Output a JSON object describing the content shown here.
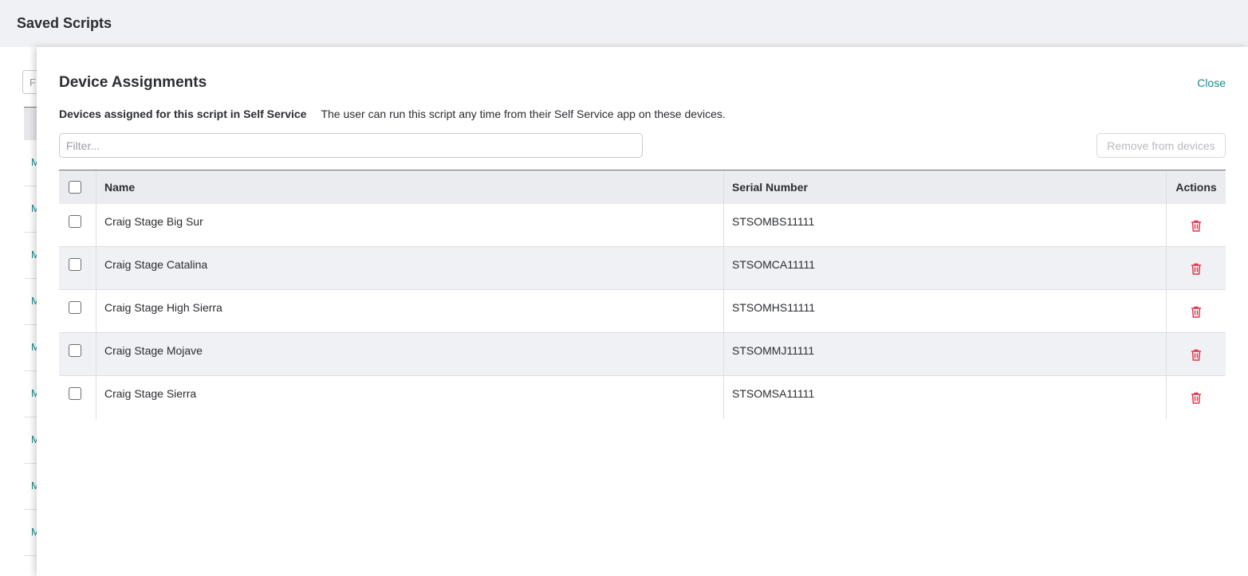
{
  "page": {
    "title": "Saved Scripts"
  },
  "background": {
    "filter_placeholder": "F",
    "row_letters": [
      "M",
      "M",
      "M",
      "M",
      "M",
      "M",
      "M",
      "M",
      "M"
    ]
  },
  "modal": {
    "title": "Device Assignments",
    "close_label": "Close",
    "subtitle_bold": "Devices assigned for this script in Self Service",
    "subtitle_text": "The user can run this script any time from their Self Service app on these devices.",
    "filter_placeholder": "Filter...",
    "remove_button_label": "Remove from devices",
    "table": {
      "headers": {
        "name": "Name",
        "serial": "Serial Number",
        "actions": "Actions"
      },
      "rows": [
        {
          "name": "Craig Stage Big Sur",
          "serial": "STSOMBS11111"
        },
        {
          "name": "Craig Stage Catalina",
          "serial": "STSOMCA11111"
        },
        {
          "name": "Craig Stage High Sierra",
          "serial": "STSOMHS11111"
        },
        {
          "name": "Craig Stage Mojave",
          "serial": "STSOMMJ11111"
        },
        {
          "name": "Craig Stage Sierra",
          "serial": "STSOMSA11111"
        }
      ]
    }
  },
  "colors": {
    "accent": "#1a8a8a",
    "danger": "#e0334a"
  },
  "icons": {
    "row_action": "trash-icon"
  }
}
